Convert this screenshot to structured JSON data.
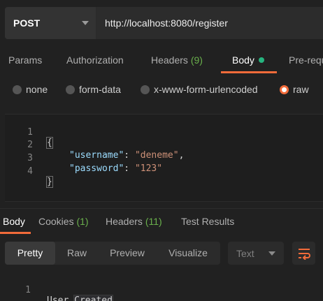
{
  "request": {
    "method": "POST",
    "url": "http://localhost:8080/register"
  },
  "request_tabs": {
    "params": "Params",
    "authorization": "Authorization",
    "headers": "Headers",
    "headers_count": "(9)",
    "body": "Body",
    "pre_request": "Pre-requ"
  },
  "body_types": {
    "none": "none",
    "form_data": "form-data",
    "urlencoded": "x-www-form-urlencoded",
    "raw": "raw",
    "selected": "raw"
  },
  "editor": {
    "lines": [
      {
        "num": "1",
        "open": "{"
      },
      {
        "num": "2",
        "key": "\"username\"",
        "sep": ": ",
        "value": "\"deneme\"",
        "end": ","
      },
      {
        "num": "3",
        "key": "\"password\"",
        "sep": ": ",
        "value": "\"123\"",
        "end": ""
      },
      {
        "num": "4",
        "close": "}"
      }
    ]
  },
  "response_tabs": {
    "body": "Body",
    "cookies": "Cookies",
    "cookies_count": "(1)",
    "headers": "Headers",
    "headers_count": "(11)",
    "test_results": "Test Results"
  },
  "response_toolbar": {
    "pretty": "Pretty",
    "raw": "Raw",
    "preview": "Preview",
    "visualize": "Visualize",
    "format": "Text",
    "wrap_icon": "wrap-lines-icon"
  },
  "response_body": {
    "line_num": "1",
    "text_a": "User ",
    "text_b": "Created"
  },
  "colors": {
    "accent": "#f26b3a",
    "count_green": "#6ab04c",
    "body_dot": "#26b47f"
  }
}
